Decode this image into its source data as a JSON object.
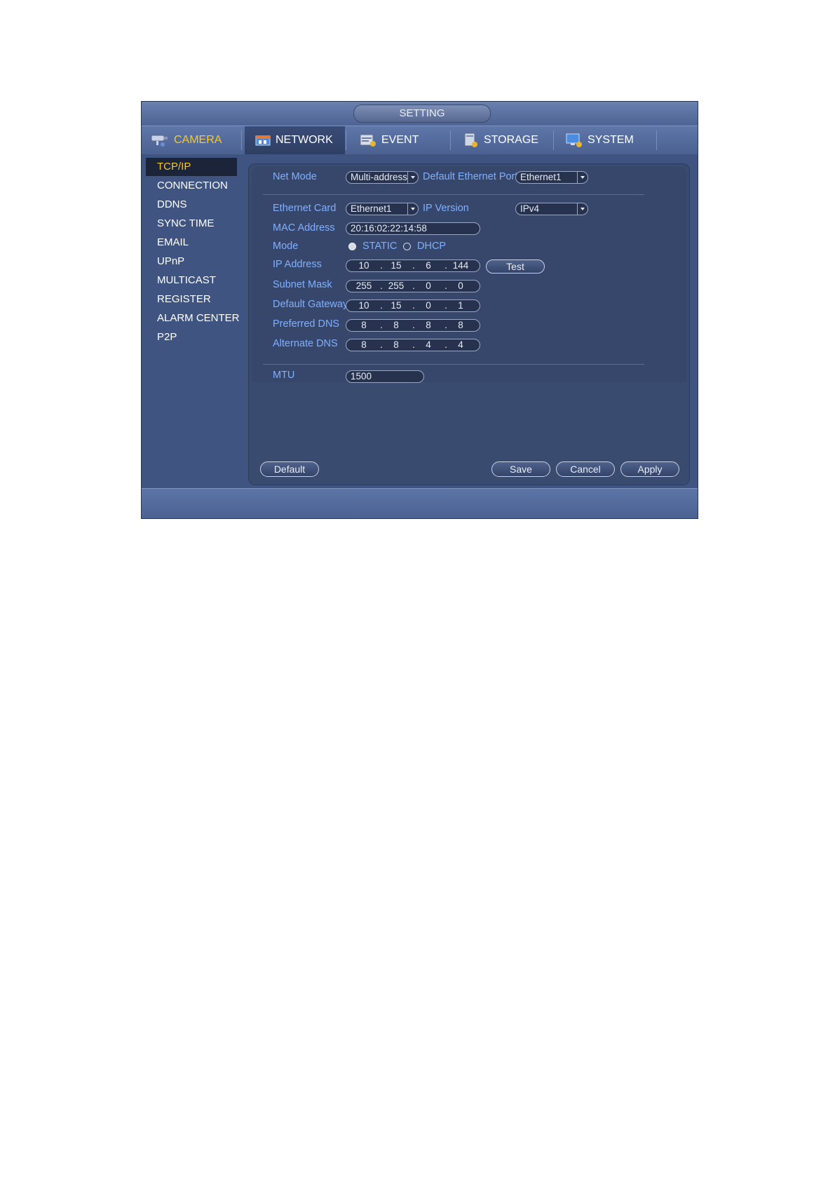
{
  "window": {
    "title": "SETTING"
  },
  "tabs": [
    {
      "label": "CAMERA",
      "icon": "camera-icon"
    },
    {
      "label": "NETWORK",
      "icon": "network-icon"
    },
    {
      "label": "EVENT",
      "icon": "event-icon"
    },
    {
      "label": "STORAGE",
      "icon": "storage-icon"
    },
    {
      "label": "SYSTEM",
      "icon": "system-icon"
    }
  ],
  "sidebar": {
    "items": [
      {
        "label": "TCP/IP"
      },
      {
        "label": "CONNECTION"
      },
      {
        "label": "DDNS"
      },
      {
        "label": "SYNC TIME"
      },
      {
        "label": "EMAIL"
      },
      {
        "label": "UPnP"
      },
      {
        "label": "MULTICAST"
      },
      {
        "label": "REGISTER"
      },
      {
        "label": "ALARM CENTER"
      },
      {
        "label": "P2P"
      }
    ]
  },
  "form": {
    "net_mode_label": "Net Mode",
    "net_mode_value": "Multi-address",
    "default_port_label": "Default Ethernet Port",
    "default_port_value": "Ethernet1",
    "ethernet_card_label": "Ethernet Card",
    "ethernet_card_value": "Ethernet1",
    "ip_version_label": "IP Version",
    "ip_version_value": "IPv4",
    "mac_label": "MAC Address",
    "mac_value": "20:16:02:22:14:58",
    "mode_label": "Mode",
    "mode_static": "STATIC",
    "mode_dhcp": "DHCP",
    "ip_label": "IP Address",
    "ip": [
      "10",
      "15",
      "6",
      "144"
    ],
    "test_button": "Test",
    "subnet_label": "Subnet Mask",
    "subnet": [
      "255",
      "255",
      "0",
      "0"
    ],
    "gateway_label": "Default Gateway",
    "gateway": [
      "10",
      "15",
      "0",
      "1"
    ],
    "pref_dns_label": "Preferred DNS",
    "pref_dns": [
      "8",
      "8",
      "8",
      "8"
    ],
    "alt_dns_label": "Alternate DNS",
    "alt_dns": [
      "8",
      "8",
      "4",
      "4"
    ],
    "mtu_label": "MTU",
    "mtu_value": "1500",
    "dot": "."
  },
  "buttons": {
    "default": "Default",
    "save": "Save",
    "cancel": "Cancel",
    "apply": "Apply"
  },
  "colors": {
    "accent_yellow": "#f4c830",
    "label_blue": "#7fb0ff",
    "panel_bg": "#3a4b70"
  }
}
